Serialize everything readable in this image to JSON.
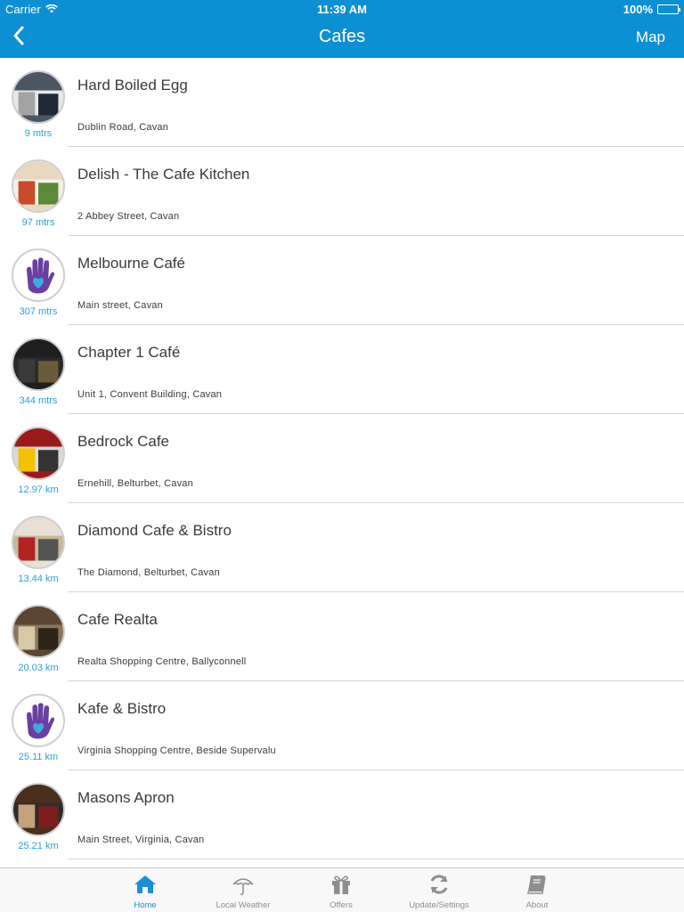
{
  "status_bar": {
    "carrier": "Carrier",
    "time": "11:39 AM",
    "battery": "100%"
  },
  "nav": {
    "title": "Cafes",
    "right_button": "Map",
    "back_icon": "chevron-left-icon"
  },
  "colors": {
    "accent": "#0c8fd3",
    "distance": "#2aa0d8",
    "tab_active": "#1a8fd6",
    "tab_inactive": "#8e8e8e"
  },
  "cafes": [
    {
      "name": "Hard Boiled Egg",
      "address": "Dublin Road, Cavan",
      "distance": "9 mtrs",
      "image": "storefront-photo"
    },
    {
      "name": "Delish - The Cafe Kitchen",
      "address": "2 Abbey Street, Cavan",
      "distance": "97 mtrs",
      "image": "food-photo"
    },
    {
      "name": "Melbourne Café",
      "address": "Main street, Cavan",
      "distance": "307 mtrs",
      "image": "hand-heart-logo"
    },
    {
      "name": "Chapter 1 Café",
      "address": "Unit 1, Convent Building, Cavan",
      "distance": "344 mtrs",
      "image": "storefront-photo"
    },
    {
      "name": "Bedrock Cafe",
      "address": "Ernehill, Belturbet, Cavan",
      "distance": "12.97 km",
      "image": "storefront-photo"
    },
    {
      "name": "Diamond Cafe & Bistro",
      "address": "The Diamond, Belturbet, Cavan",
      "distance": "13.44 km",
      "image": "storefront-photo"
    },
    {
      "name": "Cafe Realta",
      "address": "Realta Shopping Centre, Ballyconnell",
      "distance": "20.03 km",
      "image": "interior-photo"
    },
    {
      "name": "Kafe & Bistro",
      "address": "Virginia Shopping Centre, Beside Supervalu",
      "distance": "25.11 km",
      "image": "hand-heart-logo"
    },
    {
      "name": "Masons Apron",
      "address": "Main Street, Virginia, Cavan",
      "distance": "25.21 km",
      "image": "interior-photo"
    }
  ],
  "tabs": [
    {
      "label": "Home",
      "icon": "home-icon",
      "active": true
    },
    {
      "label": "Local Weather",
      "icon": "umbrella-icon",
      "active": false
    },
    {
      "label": "Offers",
      "icon": "gift-icon",
      "active": false
    },
    {
      "label": "Update/Settings",
      "icon": "refresh-icon",
      "active": false
    },
    {
      "label": "About",
      "icon": "book-icon",
      "active": false
    }
  ]
}
